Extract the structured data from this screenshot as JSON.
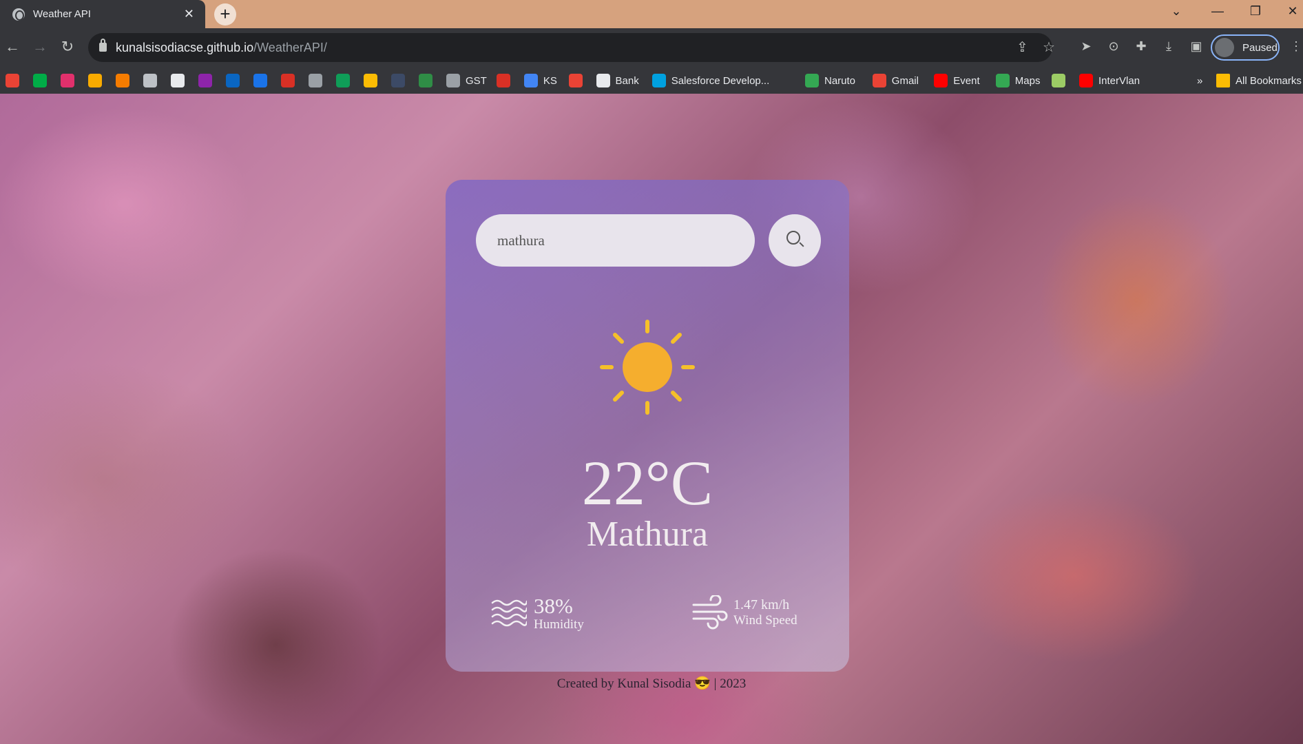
{
  "browser": {
    "tab_title": "Weather API",
    "tab_close": "✕",
    "new_tab": "+",
    "url_domain": "kunalsisodiacse.github.io",
    "url_path": "/WeatherAPI/",
    "profile_status": "Paused",
    "bookmarks": [
      {
        "label": "",
        "icon": "gmail-icon",
        "color": "#ea4335"
      },
      {
        "label": "",
        "icon": "meet-icon",
        "color": "#00ac47"
      },
      {
        "label": "",
        "icon": "instagram-icon",
        "color": "#e1306c"
      },
      {
        "label": "",
        "icon": "star-icon",
        "color": "#f9ab00"
      },
      {
        "label": "",
        "icon": "orange-app-icon",
        "color": "#f57c00"
      },
      {
        "label": "",
        "icon": "globe-icon",
        "color": "#bdc1c6"
      },
      {
        "label": "",
        "icon": "github-icon",
        "color": "#e8eaed"
      },
      {
        "label": "",
        "icon": "purple-app-icon",
        "color": "#8e24aa"
      },
      {
        "label": "",
        "icon": "linkedin-icon",
        "color": "#0a66c2"
      },
      {
        "label": "",
        "icon": "c-app-icon",
        "color": "#1a73e8"
      },
      {
        "label": "",
        "icon": "red-app-icon",
        "color": "#d93025"
      },
      {
        "label": "",
        "icon": "cc-icon",
        "color": "#9aa0a6"
      },
      {
        "label": "",
        "icon": "hr-icon",
        "color": "#0f9d58"
      },
      {
        "label": "",
        "icon": "bar-chart-icon",
        "color": "#fbbc04"
      },
      {
        "label": "",
        "icon": "h-app-icon",
        "color": "#3c4a66"
      },
      {
        "label": "",
        "icon": "gfg-icon",
        "color": "#2f8d46"
      },
      {
        "label": "GST",
        "icon": "gst-icon",
        "color": "#9aa0a6"
      },
      {
        "label": "",
        "icon": "cloud-icon",
        "color": "#d93025"
      },
      {
        "label": "KS",
        "icon": "person-icon",
        "color": "#4285f4"
      },
      {
        "label": "",
        "icon": "gmail-icon",
        "color": "#ea4335"
      },
      {
        "label": "Bank",
        "icon": "bank-icon",
        "color": "#e8eaed"
      },
      {
        "label": "Salesforce Develop...",
        "icon": "salesforce-icon",
        "color": "#00a1e0"
      },
      {
        "label": "Naruto",
        "icon": "tv-icon",
        "color": "#34a853"
      },
      {
        "label": "Gmail",
        "icon": "gmail-icon",
        "color": "#ea4335"
      },
      {
        "label": "Event",
        "icon": "youtube-icon",
        "color": "#ff0000"
      },
      {
        "label": "Maps",
        "icon": "maps-icon",
        "color": "#34a853"
      },
      {
        "label": "",
        "icon": "cube-icon",
        "color": "#9ccc65"
      },
      {
        "label": "InterVlan",
        "icon": "youtube-icon",
        "color": "#ff0000"
      }
    ],
    "more_bookmarks": "»",
    "all_bookmarks": "All Bookmarks"
  },
  "weather": {
    "search_value": "mathura",
    "temperature": "22°C",
    "city": "Mathura",
    "humidity_value": "38%",
    "humidity_label": "Humidity",
    "wind_value": "1.47 km/h",
    "wind_label": "Wind Speed",
    "icon": "sun-icon"
  },
  "footer": {
    "text": "Created by Kunal Sisodia 😎 | 2023"
  }
}
